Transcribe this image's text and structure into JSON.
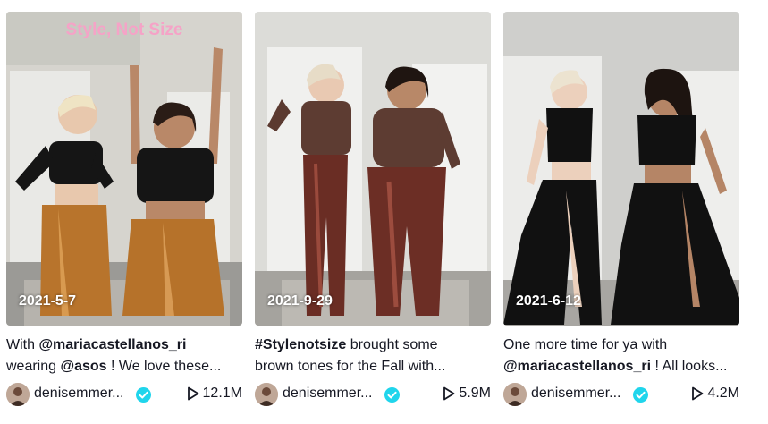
{
  "overlay_text": "Style, Not Size",
  "videos": [
    {
      "date": "2021-5-7",
      "caption_line1_prefix": "With ",
      "caption_line1_mention": "@mariacastellanos_ri",
      "caption_line2_prefix": "wearing ",
      "caption_line2_mention": "@asos",
      "caption_line2_rest": " ! We love these...",
      "author": "denisemmer...",
      "views": "12.1M"
    },
    {
      "date": "2021-9-29",
      "caption_line1_hashtag": "#Stylenotsize",
      "caption_line1_rest": " brought some",
      "caption_line2_text": "brown tones for the Fall with...",
      "author": "denisemmer...",
      "views": "5.9M"
    },
    {
      "date": "2021-6-12",
      "caption_line1_text": "One more time for ya with",
      "caption_line2_mention": "@mariacastellanos_ri",
      "caption_line2_rest": " ! All looks...",
      "author": "denisemmer...",
      "views": "4.2M"
    }
  ],
  "icons": {
    "verified": "verified-badge-icon",
    "play": "play-icon"
  },
  "colors": {
    "verified": "#20d5ec",
    "text": "#161823",
    "overlay_text": "#f5a3c7"
  }
}
